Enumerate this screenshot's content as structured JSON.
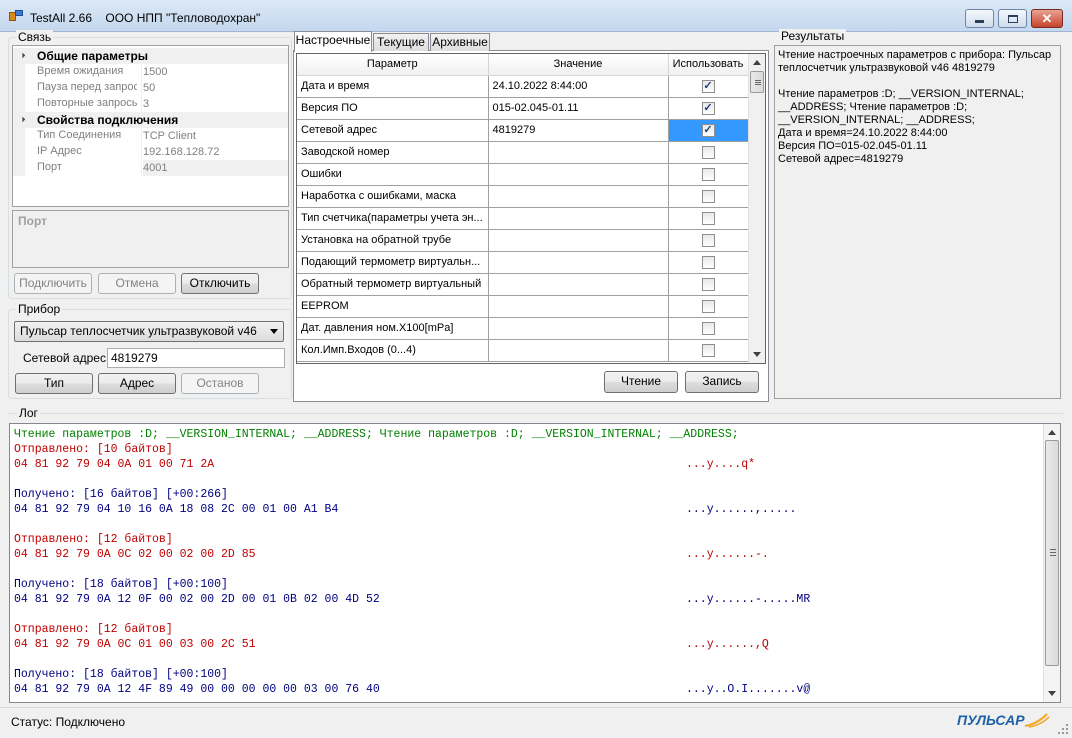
{
  "window": {
    "app": "TestAll 2.66",
    "company": "ООО НПП \"Тепловодохран\"",
    "close_glyph": "✕"
  },
  "connection": {
    "group_title": "Связь",
    "general_category": "Общие параметры",
    "general": [
      {
        "key": "Время ожидания",
        "value": "1500"
      },
      {
        "key": "Пауза перед запросом",
        "value": "50"
      },
      {
        "key": "Повторные запросы",
        "value": "3"
      }
    ],
    "connection_category": "Свойства подключения",
    "conn": [
      {
        "key": "Тип Соединения",
        "value": "TCP Client"
      },
      {
        "key": "IP Адрес",
        "value": "192.168.128.72"
      },
      {
        "key": "Порт",
        "value": "4001"
      }
    ],
    "description_title": "Порт",
    "buttons": {
      "connect": "Подключить",
      "cancel": "Отмена",
      "disconnect": "Отключить"
    }
  },
  "device": {
    "group_title": "Прибор",
    "selected": "Пульсар теплосчетчик ультразвуковой v46",
    "net_address_label": "Сетевой адрес",
    "net_address_value": "4819279",
    "buttons": {
      "type": "Тип",
      "address": "Адрес",
      "stop": "Останов"
    }
  },
  "tabs": [
    "Настроечные",
    "Текущие",
    "Архивные"
  ],
  "params_table": {
    "columns": [
      "Параметр",
      "Значение",
      "Использовать"
    ],
    "rows": [
      {
        "param": "Дата и время",
        "value": "24.10.2022 8:44:00",
        "use": true
      },
      {
        "param": "Версия ПО",
        "value": "015-02.045-01.11",
        "use": true
      },
      {
        "param": "Сетевой адрес",
        "value": "4819279",
        "use": true
      },
      {
        "param": "Заводской номер",
        "value": "",
        "use": false
      },
      {
        "param": "Ошибки",
        "value": "",
        "use": false
      },
      {
        "param": "Наработка с ошибками, маска",
        "value": "",
        "use": false
      },
      {
        "param": "Тип счетчика(параметры учета эн...",
        "value": "",
        "use": false
      },
      {
        "param": "Установка на обратной трубе",
        "value": "",
        "use": false
      },
      {
        "param": "Подающий термометр виртуальн...",
        "value": "",
        "use": false
      },
      {
        "param": "Обратный термометр виртуальный",
        "value": "",
        "use": false
      },
      {
        "param": "EEPROM",
        "value": "",
        "use": false
      },
      {
        "param": "Дат. давления ном.X100[mPa]",
        "value": "",
        "use": false
      },
      {
        "param": "Кол.Имп.Входов (0...4)",
        "value": "",
        "use": false
      }
    ],
    "check_glyph": "✓",
    "buttons": {
      "read": "Чтение",
      "write": "Запись"
    }
  },
  "results": {
    "group_title": "Результаты",
    "text": "Чтение настроечных параметров с прибора: Пульсар теплосчетчик ультразвуковой v46 4819279\n\nЧтение параметров :D; __VERSION_INTERNAL; __ADDRESS; Чтение параметров :D; __VERSION_INTERNAL; __ADDRESS;\nДата и время=24.10.2022 8:44:00\nВерсия ПО=015-02.045-01.11\nСетевой адрес=4819279"
  },
  "log": {
    "group_title": "Лог",
    "colors": {
      "command": "#008000",
      "sent": "#c00000",
      "received": "#000080"
    },
    "lines": [
      {
        "text": "Чтение параметров :D; __VERSION_INTERNAL; __ADDRESS; Чтение параметров :D; __VERSION_INTERNAL; __ADDRESS;",
        "ascii": "",
        "kind": "command"
      },
      {
        "text": "Отправлено: [10 байтов]",
        "ascii": "",
        "kind": "sent"
      },
      {
        "text": "04 81 92 79 04 0A 01 00 71 2A",
        "ascii": "...y....q*",
        "kind": "sent"
      },
      {
        "text": "",
        "ascii": "",
        "kind": "sent"
      },
      {
        "text": "Получено: [16 байтов] [+00:266]",
        "ascii": "",
        "kind": "received"
      },
      {
        "text": "04 81 92 79 04 10 16 0A 18 08 2C 00 01 00 A1 B4",
        "ascii": "...y......,.....",
        "kind": "received"
      },
      {
        "text": "",
        "ascii": "",
        "kind": "received"
      },
      {
        "text": "Отправлено: [12 байтов]",
        "ascii": "",
        "kind": "sent"
      },
      {
        "text": "04 81 92 79 0A 0C 02 00 02 00 2D 85",
        "ascii": "...y......-.",
        "kind": "sent"
      },
      {
        "text": "",
        "ascii": "",
        "kind": "sent"
      },
      {
        "text": "Получено: [18 байтов] [+00:100]",
        "ascii": "",
        "kind": "received"
      },
      {
        "text": "04 81 92 79 0A 12 0F 00 02 00 2D 00 01 0B 02 00 4D 52",
        "ascii": "...y......-.....MR",
        "kind": "received"
      },
      {
        "text": "",
        "ascii": "",
        "kind": "received"
      },
      {
        "text": "Отправлено: [12 байтов]",
        "ascii": "",
        "kind": "sent"
      },
      {
        "text": "04 81 92 79 0A 0C 01 00 03 00 2C 51",
        "ascii": "...y......,Q",
        "kind": "sent"
      },
      {
        "text": "",
        "ascii": "",
        "kind": "sent"
      },
      {
        "text": "Получено: [18 байтов] [+00:100]",
        "ascii": "",
        "kind": "received"
      },
      {
        "text": "04 81 92 79 0A 12 4F 89 49 00 00 00 00 00 03 00 76 40",
        "ascii": "...y..O.I.......v@",
        "kind": "received"
      }
    ]
  },
  "status": {
    "text": "Статус: Подключено",
    "logo_text": "ПУЛЬСАР",
    "logo_color": "#1f5fa8",
    "logo_accent": "#f5a623"
  },
  "theme": {
    "selection": "#3399ff"
  }
}
